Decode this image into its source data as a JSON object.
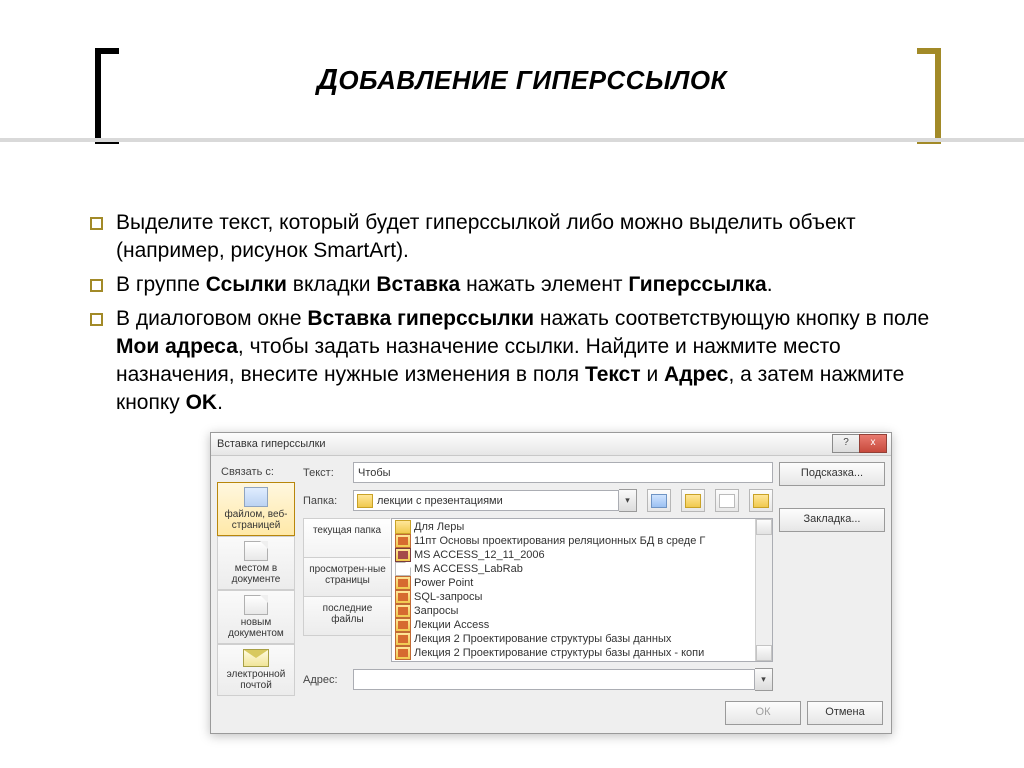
{
  "title_firstLetter": "Д",
  "title_rest": "ОБАВЛЕНИЕ ГИПЕРССЫЛОК",
  "bullets": {
    "b1": "Выделите текст, который будет гиперссылкой либо можно выделить объект (например, рисунок SmartArt).",
    "b2_a": "В группе ",
    "b2_b": "Ссылки",
    "b2_c": " вкладки ",
    "b2_d": "Вставка",
    "b2_e": " нажать элемент ",
    "b2_f": "Гиперссылка",
    "b2_g": ".",
    "b3_a": "В диалоговом окне ",
    "b3_b": "Вставка гиперссылки",
    "b3_c": " нажать соответствующую кнопку в поле ",
    "b3_d": "Мои адреса",
    "b3_e": ", чтобы задать назначение ссылки. Найдите и нажмите место назначения, внесите нужные изменения в поля ",
    "b3_f": "Текст",
    "b3_g": " и ",
    "b3_h": "Адрес",
    "b3_i": ", а затем нажмите кнопку ",
    "b3_j": "OK",
    "b3_k": "."
  },
  "dialog": {
    "title": "Вставка гиперссылки",
    "help": "?",
    "close": "x",
    "linkto_label": "Связать с:",
    "linkto": {
      "file": "файлом, веб-страницей",
      "place": "местом в документе",
      "newdoc": "новым документом",
      "email": "электронной почтой"
    },
    "text_label": "Текст:",
    "text_value": "Чтобы",
    "folder_label": "Папка:",
    "folder_value": "лекции с презентациями",
    "tabs": {
      "current": "текущая папка",
      "browsed": "просмотрен-ные страницы",
      "recent": "последние файлы"
    },
    "files": {
      "f0": "Для Леры",
      "f1": "11пт Основы проектирования реляционных БД в среде Г",
      "f2": "MS ACCESS_12_11_2006",
      "f3": "MS ACCESS_LabRab",
      "f4": "Power Point",
      "f5": "SQL-запросы",
      "f6": "Запросы",
      "f7": "Лекции Access",
      "f8": "Лекция 2 Проектирование структуры базы данных",
      "f9": "Лекция 2 Проектирование структуры базы данных - копи"
    },
    "addr_label": "Адрес:",
    "addr_value": "",
    "hint_btn": "Подсказка...",
    "bookmark_btn": "Закладка...",
    "ok": "ОК",
    "cancel": "Отмена"
  }
}
